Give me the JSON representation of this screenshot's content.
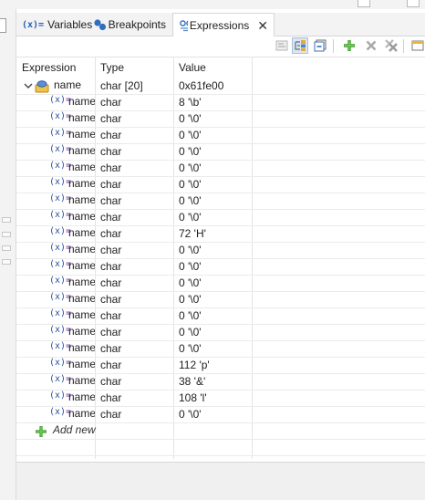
{
  "tabs": [
    {
      "id": "variables",
      "label": "Variables",
      "icon": "variables-icon",
      "active": false
    },
    {
      "id": "breakpoints",
      "label": "Breakpoints",
      "icon": "breakpoints-icon",
      "active": false
    },
    {
      "id": "expressions",
      "label": "Expressions",
      "icon": "expressions-icon",
      "active": true,
      "closable": true
    }
  ],
  "tab_icon_text": {
    "variables": "(x)="
  },
  "toolbar": {
    "buttons": [
      {
        "name": "show-type-names-button",
        "icon": "type-names-icon",
        "enabled": false
      },
      {
        "name": "show-logical-structure-button",
        "icon": "logical-structure-icon",
        "pressed": true
      },
      {
        "name": "collapse-all-button",
        "icon": "collapse-all-icon"
      },
      {
        "name": "add-watch-expression-button",
        "icon": "add-icon"
      },
      {
        "name": "remove-expression-button",
        "icon": "remove-icon",
        "enabled": false
      },
      {
        "name": "remove-all-expressions-button",
        "icon": "remove-all-icon",
        "enabled": false
      },
      {
        "name": "open-new-view-button",
        "icon": "new-view-icon"
      }
    ]
  },
  "columns": {
    "expression": "Expression",
    "type": "Type",
    "value": "Value"
  },
  "parent": {
    "expression": "name",
    "type": "char [20]",
    "value": "0x61fe00",
    "expanded": true
  },
  "child_icon_text": {
    "left": "(x)",
    "right": "="
  },
  "children": [
    {
      "expression": "name",
      "type": "char",
      "value": "8 '\\b'"
    },
    {
      "expression": "name",
      "type": "char",
      "value": "0 '\\0'"
    },
    {
      "expression": "name",
      "type": "char",
      "value": "0 '\\0'"
    },
    {
      "expression": "name",
      "type": "char",
      "value": "0 '\\0'"
    },
    {
      "expression": "name",
      "type": "char",
      "value": "0 '\\0'"
    },
    {
      "expression": "name",
      "type": "char",
      "value": "0 '\\0'"
    },
    {
      "expression": "name",
      "type": "char",
      "value": "0 '\\0'"
    },
    {
      "expression": "name",
      "type": "char",
      "value": "0 '\\0'"
    },
    {
      "expression": "name",
      "type": "char",
      "value": "72 'H'"
    },
    {
      "expression": "name",
      "type": "char",
      "value": "0 '\\0'"
    },
    {
      "expression": "name",
      "type": "char",
      "value": "0 '\\0'"
    },
    {
      "expression": "name",
      "type": "char",
      "value": "0 '\\0'"
    },
    {
      "expression": "name",
      "type": "char",
      "value": "0 '\\0'"
    },
    {
      "expression": "name",
      "type": "char",
      "value": "0 '\\0'"
    },
    {
      "expression": "name",
      "type": "char",
      "value": "0 '\\0'"
    },
    {
      "expression": "name",
      "type": "char",
      "value": "0 '\\0'"
    },
    {
      "expression": "name",
      "type": "char",
      "value": "112 'p'"
    },
    {
      "expression": "name",
      "type": "char",
      "value": "38 '&'"
    },
    {
      "expression": "name",
      "type": "char",
      "value": "108 'l'"
    },
    {
      "expression": "name",
      "type": "char",
      "value": "0 '\\0'"
    }
  ],
  "add_new_label": "Add new",
  "colors": {
    "accent": "#1f5fb0",
    "add_green": "#3a9a2a",
    "pressed_bg": "#dbe6f4"
  }
}
